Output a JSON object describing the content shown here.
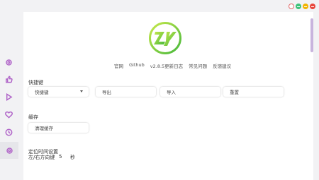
{
  "window_controls": {
    "refresh": "refresh-icon",
    "pin": "pin-icon",
    "minimize": "minimize-icon",
    "close": "close-icon"
  },
  "sidebar": {
    "items": [
      {
        "icon": "settings-gear-icon"
      },
      {
        "icon": "thumbs-up-icon"
      },
      {
        "icon": "play-icon"
      },
      {
        "icon": "heart-icon"
      },
      {
        "icon": "history-clock-icon"
      },
      {
        "icon": "settings-gear-icon",
        "active": true
      }
    ]
  },
  "header": {
    "logo": "zy-logo",
    "links": [
      "官网",
      "Github",
      "v2.8.5更新日志",
      "常见问题",
      "反馈建议"
    ]
  },
  "shortcuts": {
    "title": "快捷键",
    "dropdown_value": "快捷键",
    "export_label": "导出",
    "import_label": "导入",
    "reset_label": "重置"
  },
  "cache": {
    "title": "缓存",
    "clear_label": "清理缓存"
  },
  "seek": {
    "title": "定位时间设置",
    "label": "左/右方向键",
    "value": "5",
    "unit": "秒"
  },
  "colors": {
    "accent": "#b064c8",
    "logo_green": "#8bd63a"
  }
}
